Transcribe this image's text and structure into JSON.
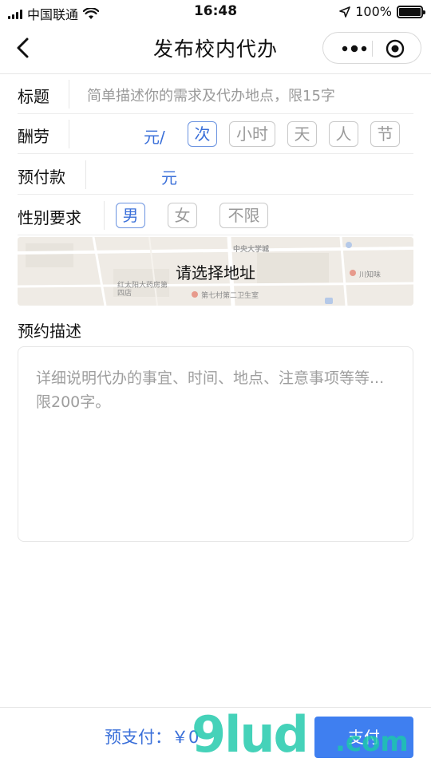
{
  "status_bar": {
    "carrier": "中国联通",
    "time": "16:48",
    "battery": "100%",
    "battery_level": 1.0
  },
  "nav": {
    "title": "发布校内代办"
  },
  "form": {
    "title_row": {
      "label": "标题",
      "placeholder": "简单描述你的需求及代办地点，限15字"
    },
    "reward_row": {
      "label": "酬劳",
      "unit": "元/",
      "options": [
        {
          "label": "次",
          "selected": true
        },
        {
          "label": "小时",
          "selected": false
        },
        {
          "label": "天",
          "selected": false
        },
        {
          "label": "人",
          "selected": false
        },
        {
          "label": "节",
          "selected": false
        }
      ]
    },
    "prepay_row": {
      "label": "预付款",
      "unit": "元"
    },
    "gender_row": {
      "label": "性别要求",
      "options": [
        {
          "label": "男",
          "selected": true
        },
        {
          "label": "女",
          "selected": false
        },
        {
          "label": "不限",
          "selected": false
        }
      ]
    },
    "address": {
      "cta": "请选择地址",
      "map_labels": [
        "中央大学城",
        "红太阳大药房第四店",
        "第七村第二卫生室",
        "川知味"
      ]
    },
    "description": {
      "label": "预约描述",
      "placeholder": "详细说明代办的事宜、时间、地点、注意事项等等...限200字。"
    }
  },
  "bottom_bar": {
    "prepay_text": "预支付：￥0",
    "pay_button": "支付"
  },
  "watermark": {
    "main": "9lud",
    "suffix": ".com"
  },
  "colors": {
    "accent": "#3a6fd9",
    "button": "#3f7ff0",
    "placeholder": "#9a9a9a",
    "watermark": "#1cc8aa"
  },
  "icons": [
    "back-chevron-icon",
    "more-dots-icon",
    "close-target-icon",
    "wifi-icon",
    "location-arrow-icon"
  ]
}
